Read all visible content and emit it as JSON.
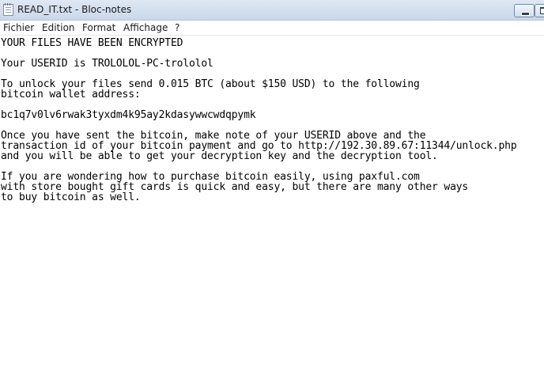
{
  "window": {
    "title": "READ_IT.txt - Bloc-notes"
  },
  "menu": {
    "items": [
      "Fichier",
      "Edition",
      "Format",
      "Affichage",
      "?"
    ]
  },
  "document": {
    "lines": [
      "YOUR FILES HAVE BEEN ENCRYPTED",
      "Your USERID is TROLOLOL-PC-trololol",
      "To unlock your files send 0.015 BTC (about $150 USD) to the following",
      "bitcoin wallet address:",
      "bc1q7v0lv6rwak3tyxdm4k95ay2kdasywwcwdqpymk",
      "Once you have sent the bitcoin, make note of your USERID above and the",
      "transaction id of your bitcoin payment and go to http://192.30.89.67:11344/unlock.php",
      "and you will be able to get your decryption key and the decryption tool.",
      "If you are wondering how to purchase bitcoin easily, using paxful.com",
      "with store bought gift cards is quick and easy, but there are many other ways",
      "to buy bitcoin as well."
    ]
  }
}
